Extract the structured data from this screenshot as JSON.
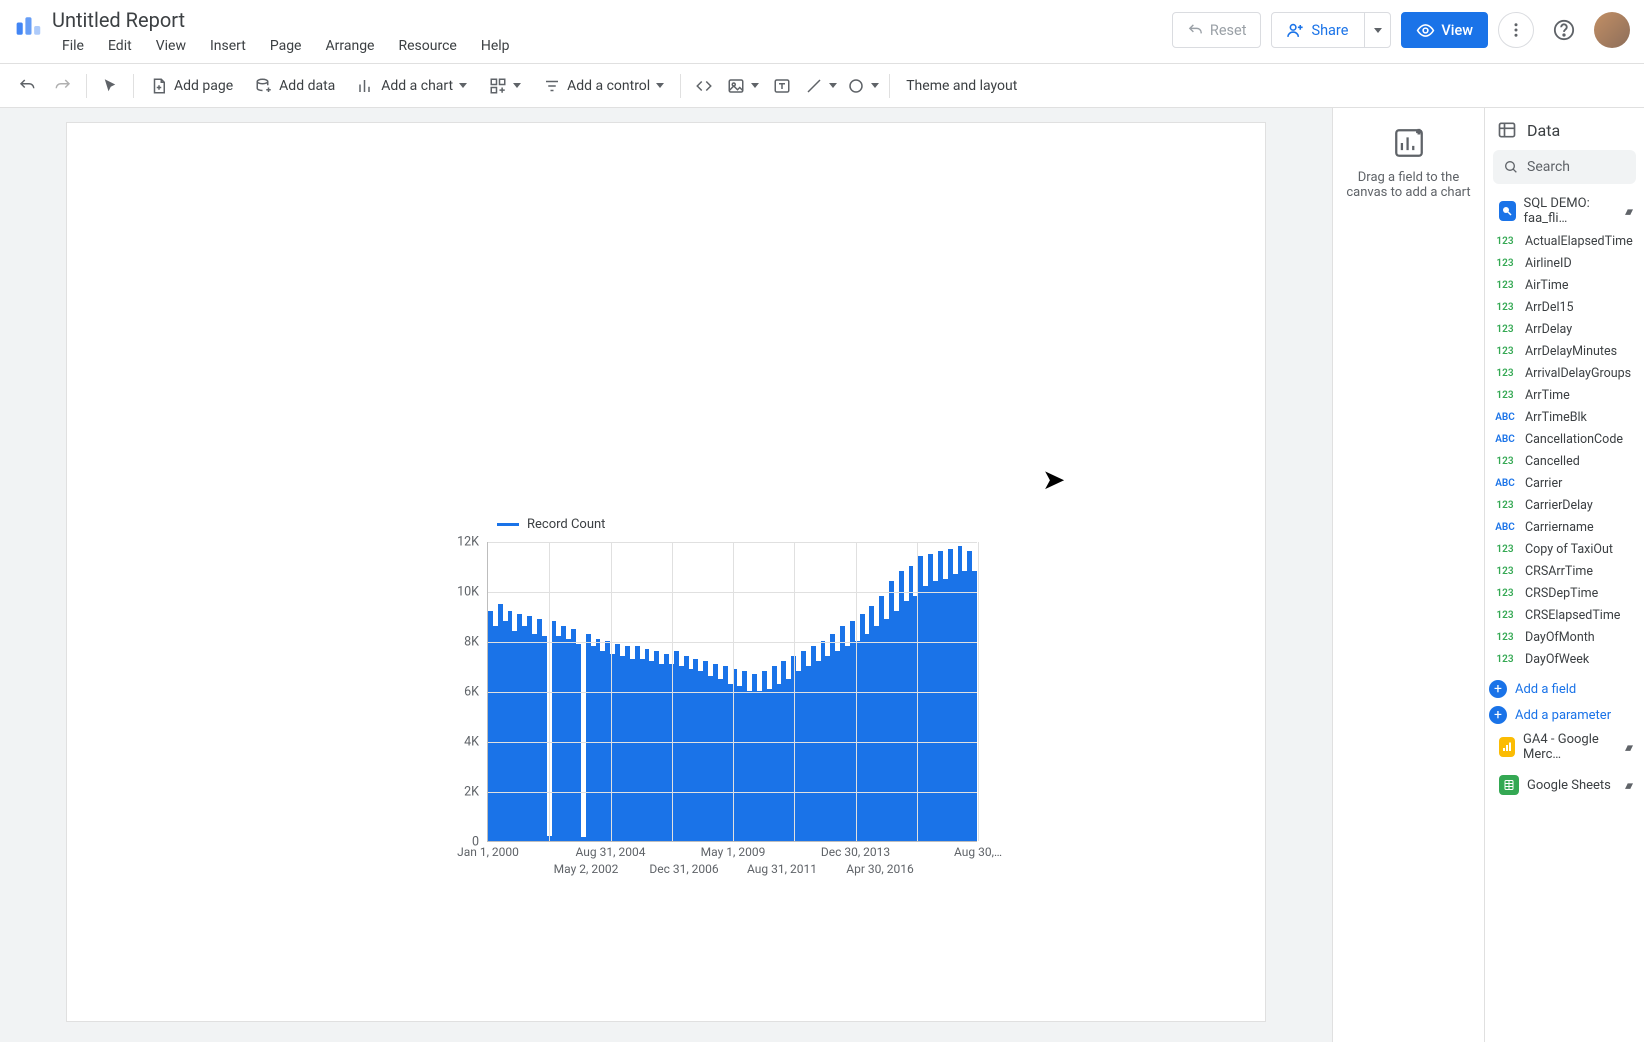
{
  "header": {
    "title": "Untitled Report",
    "menus": [
      "File",
      "Edit",
      "View",
      "Insert",
      "Page",
      "Arrange",
      "Resource",
      "Help"
    ],
    "reset": "Reset",
    "share": "Share",
    "view": "View"
  },
  "toolbar": {
    "add_page": "Add page",
    "add_data": "Add data",
    "add_chart": "Add a chart",
    "add_control": "Add a control",
    "theme": "Theme and layout"
  },
  "drop_hint": "Drag a field to the canvas to add a chart",
  "data_panel": {
    "title": "Data",
    "search_placeholder": "Search",
    "datasource_primary": "SQL DEMO: faa_fli…",
    "datasource_ga4": "GA4 - Google Merc…",
    "datasource_sheets": "Google Sheets",
    "add_field": "Add a field",
    "add_parameter": "Add a parameter",
    "fields": [
      {
        "t": "num",
        "n": "ActualElapsedTime"
      },
      {
        "t": "num",
        "n": "AirlineID"
      },
      {
        "t": "num",
        "n": "AirTime"
      },
      {
        "t": "num",
        "n": "ArrDel15"
      },
      {
        "t": "num",
        "n": "ArrDelay"
      },
      {
        "t": "num",
        "n": "ArrDelayMinutes"
      },
      {
        "t": "num",
        "n": "ArrivalDelayGroups"
      },
      {
        "t": "num",
        "n": "ArrTime"
      },
      {
        "t": "txt",
        "n": "ArrTimeBlk"
      },
      {
        "t": "txt",
        "n": "CancellationCode"
      },
      {
        "t": "num",
        "n": "Cancelled"
      },
      {
        "t": "txt",
        "n": "Carrier"
      },
      {
        "t": "num",
        "n": "CarrierDelay"
      },
      {
        "t": "txt",
        "n": "Carriername"
      },
      {
        "t": "num",
        "n": "Copy of TaxiOut"
      },
      {
        "t": "num",
        "n": "CRSArrTime"
      },
      {
        "t": "num",
        "n": "CRSDepTime"
      },
      {
        "t": "num",
        "n": "CRSElapsedTime"
      },
      {
        "t": "num",
        "n": "DayOfMonth"
      },
      {
        "t": "num",
        "n": "DayOfWeek"
      }
    ]
  },
  "chart_data": {
    "type": "line",
    "title": "",
    "legend": "Record Count",
    "ylabel": "",
    "xlabel": "",
    "ylim": [
      0,
      12000
    ],
    "y_ticks": [
      {
        "v": 0,
        "l": "0"
      },
      {
        "v": 2000,
        "l": "2K"
      },
      {
        "v": 4000,
        "l": "4K"
      },
      {
        "v": 6000,
        "l": "6K"
      },
      {
        "v": 8000,
        "l": "8K"
      },
      {
        "v": 10000,
        "l": "10K"
      },
      {
        "v": 12000,
        "l": "12K"
      }
    ],
    "x_ticks_top": [
      "Jan 1, 2000",
      "Aug 31, 2004",
      "May 1, 2009",
      "Dec 30, 2013",
      "Aug 30,…"
    ],
    "x_ticks_bottom": [
      "May 2, 2002",
      "Dec 31, 2006",
      "Aug 31, 2011",
      "Apr 30, 2016"
    ],
    "series": [
      {
        "name": "Record Count",
        "color": "#1a73e8",
        "approx_values": [
          9200,
          8600,
          9500,
          8800,
          9200,
          8400,
          9100,
          8600,
          9000,
          8300,
          8900,
          8200,
          200,
          8800,
          8200,
          8600,
          8100,
          8500,
          7900,
          150,
          8300,
          7800,
          8100,
          7600,
          8000,
          7500,
          7900,
          7400,
          7800,
          7300,
          7800,
          7300,
          7700,
          7200,
          7600,
          7100,
          7500,
          7100,
          7600,
          7000,
          7400,
          6900,
          7300,
          6800,
          7200,
          6600,
          7100,
          6500,
          7000,
          6300,
          6900,
          6200,
          6800,
          6000,
          6700,
          6000,
          6800,
          6100,
          7000,
          6300,
          7200,
          6500,
          7400,
          6800,
          7600,
          7000,
          7800,
          7200,
          8000,
          7400,
          8300,
          7600,
          8600,
          7800,
          8800,
          8000,
          9100,
          8300,
          9400,
          8600,
          9800,
          8900,
          10400,
          9200,
          10800,
          9600,
          11000,
          9800,
          11400,
          10200,
          11500,
          10400,
          11600,
          10500,
          11700,
          10700,
          11800,
          10800,
          11600,
          10800
        ]
      }
    ]
  }
}
